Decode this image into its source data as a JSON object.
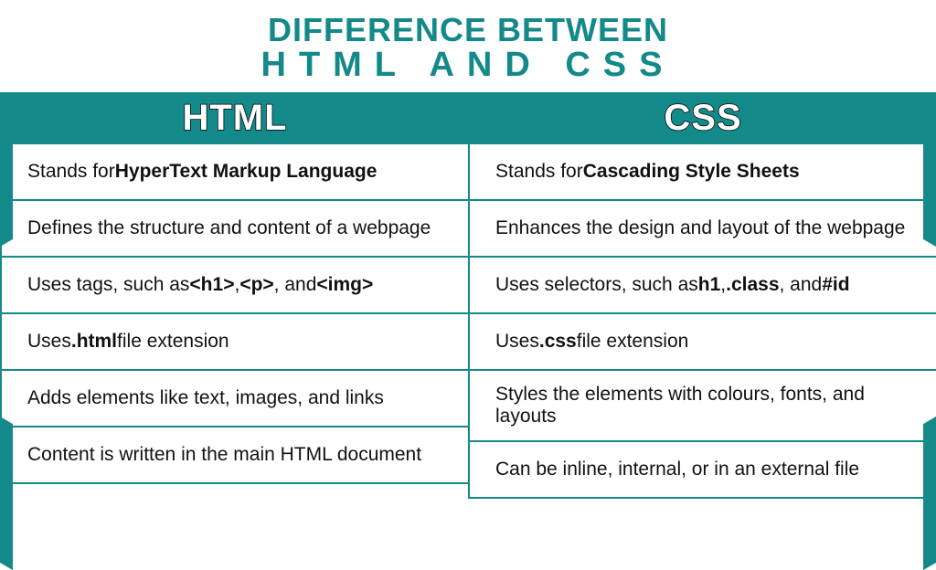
{
  "title": {
    "line1": "DIFFERENCE BETWEEN",
    "line2": "HTML AND CSS"
  },
  "columns": {
    "left": {
      "header": "HTML",
      "rows": [
        "Stands for <b>HyperText Markup Language</b>",
        "Defines the structure and content of a webpage",
        "Uses tags, such as <b>&lt;h1&gt;</b>, <b>&lt;p&gt;</b>, and <b>&lt;img&gt;</b>",
        "Uses <b>.html</b> file extension",
        "Adds elements like text, images, and links",
        "Content is written in the main HTML document"
      ]
    },
    "right": {
      "header": "CSS",
      "rows": [
        "Stands for <b>Cascading Style Sheets</b>",
        "Enhances the design and layout of the webpage",
        "Uses selectors, such as <b>h1</b>, <b>.class</b>, and <b>#id</b>",
        "Uses <b>.css</b> file extension",
        "Styles the elements with colours, fonts, and layouts",
        "Can be inline, internal, or in an external file"
      ]
    }
  }
}
